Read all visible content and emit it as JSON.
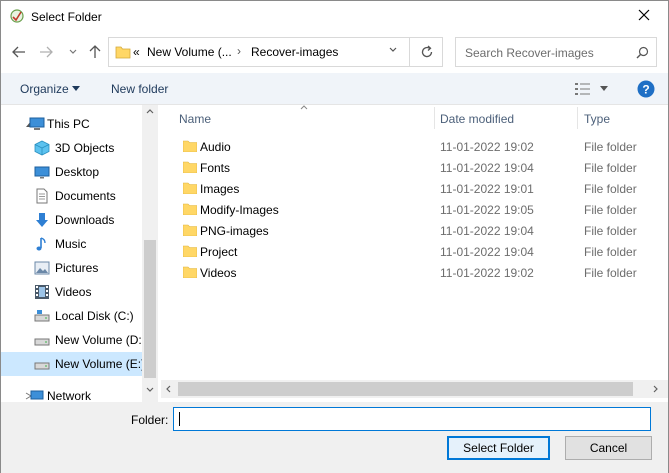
{
  "window": {
    "title": "Select Folder"
  },
  "nav": {
    "address_segments": [
      "«",
      "New Volume (...",
      "Recover-images"
    ],
    "search_placeholder": "Search Recover-images"
  },
  "toolbar": {
    "organize": "Organize",
    "new_folder": "New folder"
  },
  "sidebar": {
    "items": [
      {
        "label": "This PC",
        "icon": "this-pc-icon"
      },
      {
        "label": "3D Objects",
        "icon": "3d-objects-icon"
      },
      {
        "label": "Desktop",
        "icon": "desktop-icon"
      },
      {
        "label": "Documents",
        "icon": "documents-icon"
      },
      {
        "label": "Downloads",
        "icon": "downloads-icon"
      },
      {
        "label": "Music",
        "icon": "music-icon"
      },
      {
        "label": "Pictures",
        "icon": "pictures-icon"
      },
      {
        "label": "Videos",
        "icon": "videos-icon"
      },
      {
        "label": "Local Disk (C:)",
        "icon": "drive-icon"
      },
      {
        "label": "New Volume (D:",
        "icon": "drive-icon"
      },
      {
        "label": "New Volume (E:)",
        "icon": "drive-icon"
      },
      {
        "label": "Network",
        "icon": "network-icon"
      }
    ]
  },
  "columns": {
    "name": "Name",
    "date": "Date modified",
    "type": "Type"
  },
  "files": [
    {
      "name": "Audio",
      "date": "11-01-2022 19:02",
      "type": "File folder"
    },
    {
      "name": "Fonts",
      "date": "11-01-2022 19:04",
      "type": "File folder"
    },
    {
      "name": "Images",
      "date": "11-01-2022 19:01",
      "type": "File folder"
    },
    {
      "name": "Modify-Images",
      "date": "11-01-2022 19:05",
      "type": "File folder"
    },
    {
      "name": "PNG-images",
      "date": "11-01-2022 19:04",
      "type": "File folder"
    },
    {
      "name": "Project",
      "date": "11-01-2022 19:04",
      "type": "File folder"
    },
    {
      "name": "Videos",
      "date": "11-01-2022 19:02",
      "type": "File folder"
    }
  ],
  "footer": {
    "folder_label": "Folder:",
    "folder_value": "",
    "select_button": "Select Folder",
    "cancel_button": "Cancel"
  },
  "colors": {
    "accent": "#0078d7",
    "selection": "#cce8ff",
    "folder": "#ffd766"
  }
}
